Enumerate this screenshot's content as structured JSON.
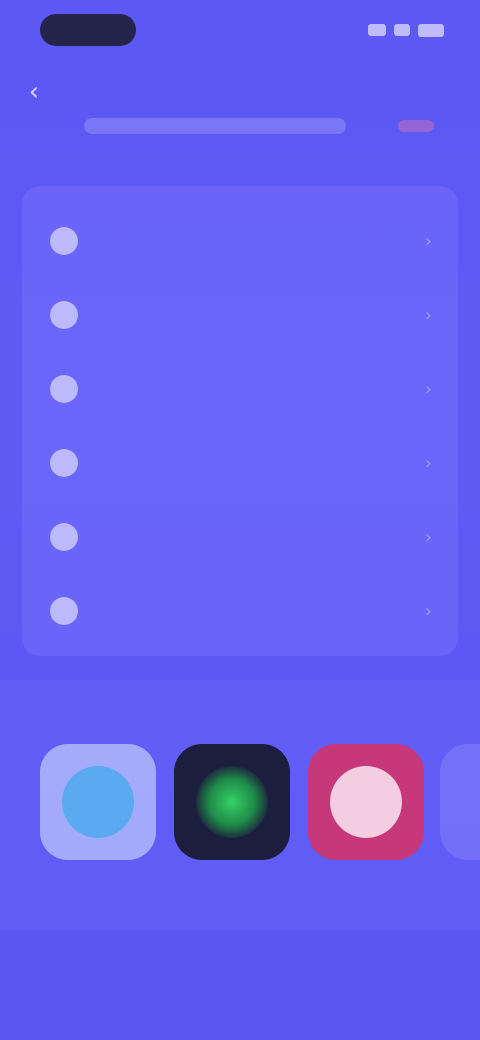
{
  "status_bar": {
    "time": "",
    "icons": [
      "signal-icon",
      "wifi-icon",
      "battery-icon"
    ]
  },
  "header": {
    "title": "",
    "back_icon": "chevron-left-icon"
  },
  "menu": {
    "items": [
      {
        "label": "",
        "icon": "circle-icon"
      },
      {
        "label": "",
        "icon": "circle-icon"
      },
      {
        "label": "",
        "icon": "circle-icon"
      },
      {
        "label": "",
        "icon": "circle-icon"
      },
      {
        "label": "",
        "icon": "circle-icon"
      },
      {
        "label": "",
        "icon": "circle-icon"
      }
    ]
  },
  "apps": {
    "section_label": "",
    "items": [
      {
        "name": "",
        "subtitle": "",
        "icon": "blue-circle-app-icon",
        "color": "#5aaaf2"
      },
      {
        "name": "",
        "subtitle": "",
        "icon": "green-star-app-icon",
        "color": "#2fc05a"
      },
      {
        "name": "",
        "subtitle": "",
        "icon": "pink-circle-app-icon",
        "color": "#f3cde0"
      }
    ]
  },
  "colors": {
    "background": "#5b57f2",
    "card": "#7d78ff"
  }
}
